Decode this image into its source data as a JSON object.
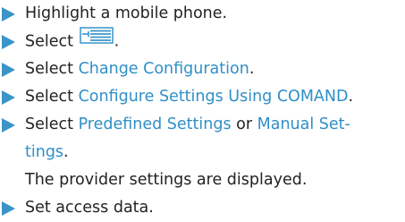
{
  "accent_color": "#3a94c8",
  "link_color": "#2f8fc7",
  "text_color": "#222222",
  "bullet_icon": "arrow-right-icon",
  "steps": [
    {
      "text": "Highlight a mobile phone."
    },
    {
      "text_before": "Select ",
      "icon": "menu-list-button-icon",
      "text_after": "."
    },
    {
      "text_before": "Select ",
      "link": "Change Configuration",
      "text_after": "."
    },
    {
      "text_before": "Select ",
      "link": "Configure Settings Using COMAND",
      "text_after": "."
    },
    {
      "text_before": "Select ",
      "link1": "Predefined Settings",
      "middle": " or ",
      "link2_line1": "Manual Set-",
      "link2_line2": "tings",
      "text_after": ".",
      "result": "The provider settings are displayed."
    },
    {
      "text": "Set access data."
    }
  ]
}
